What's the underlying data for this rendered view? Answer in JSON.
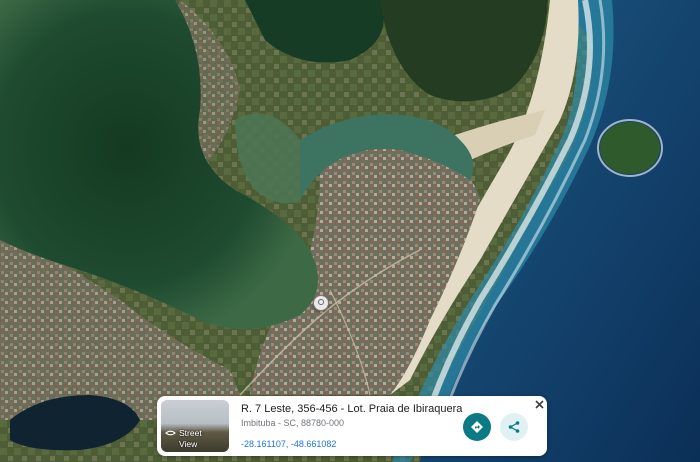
{
  "map": {
    "type": "satellite",
    "colors": {
      "ocean": "#0f3f6e",
      "lagoon": "#1f4a33",
      "land": "#4f5f3a",
      "beach": "#e4dcc6",
      "surf": "#ffffff"
    }
  },
  "place_card": {
    "title": "R. 7 Leste, 356-456 - Lot. Praia de Ibiraquera",
    "subtitle": "Imbituba - SC, 88780-000",
    "coordinates": "-28.161107, -48.661082",
    "street_view_line1": "Street",
    "street_view_line2": "View",
    "icons": {
      "directions": "directions-icon",
      "share": "share-icon",
      "close": "close-icon",
      "street_view": "street-view-icon",
      "pin": "location-pin-icon"
    },
    "accent_color": "#0b7a84"
  }
}
